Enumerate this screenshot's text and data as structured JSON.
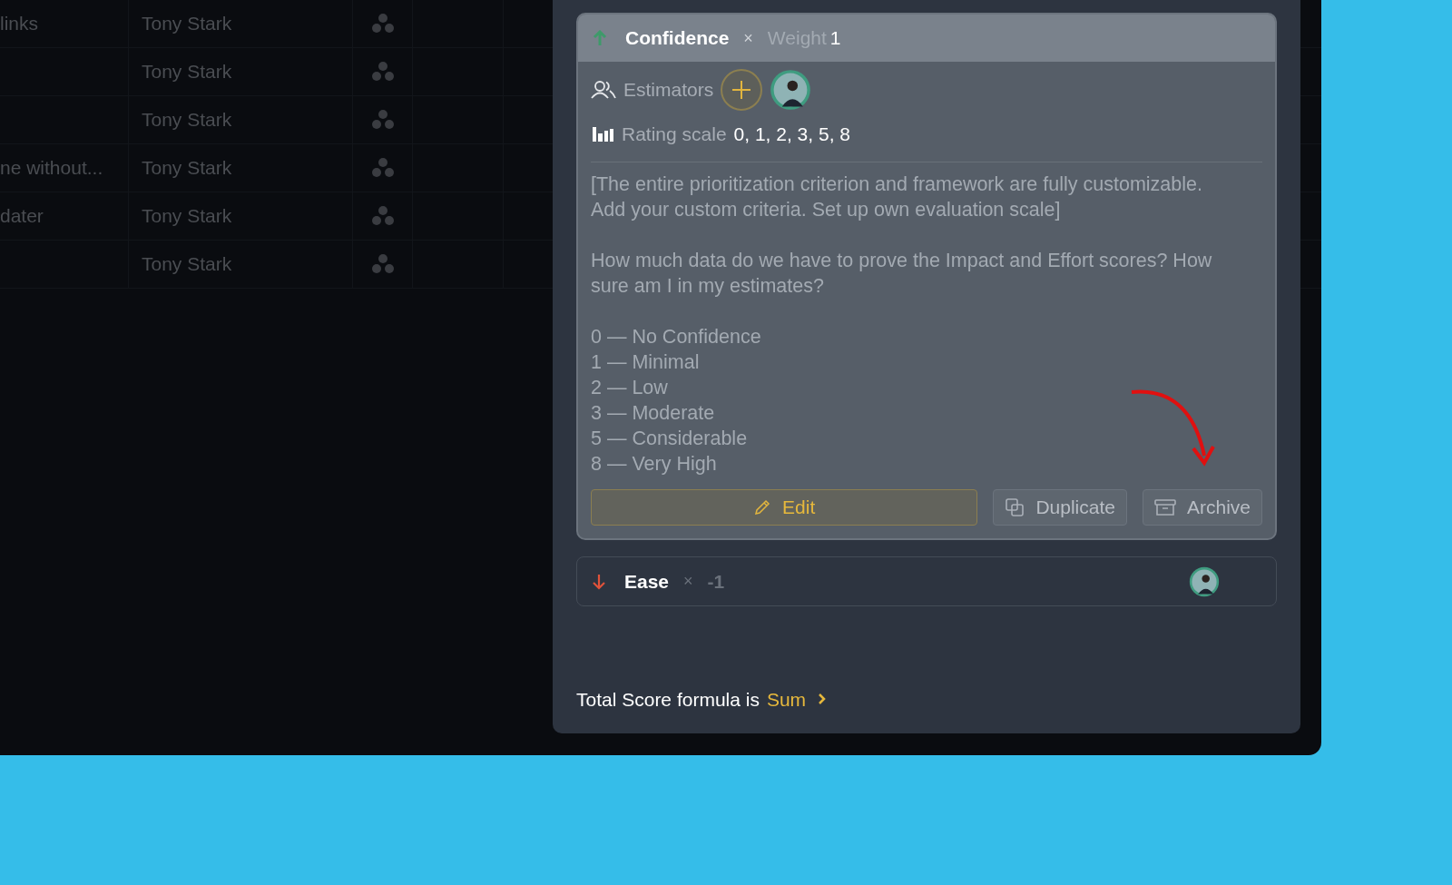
{
  "table": {
    "rows": [
      {
        "column_1": "links",
        "column_2": "Tony Stark"
      },
      {
        "column_2": "Tony Stark"
      },
      {
        "column_2": "Tony Stark"
      },
      {
        "column_1": "ne without...",
        "column_2": "Tony Stark"
      },
      {
        "column_1": "dater",
        "column_2": "Tony Stark"
      },
      {
        "column_2": "Tony Stark"
      }
    ]
  },
  "criteria": [
    {
      "name": "Confidence",
      "kind": "up",
      "operator": "×",
      "multiplier_label": "Weight",
      "weight": "1",
      "expanded": true,
      "estimators_label": "Estimators",
      "rating_label": "Rating scale",
      "rating_values": "0, 1, 2, 3, 5, 8",
      "description": [
        {
          "lines": [
            "[The entire prioritization criterion and framework are fully customizable.",
            "Add your custom criteria. Set up own evaluation scale]"
          ]
        },
        {
          "lines": [
            "How much data do we have to prove the Impact and Effort scores? How",
            "sure am I in my estimates?"
          ]
        }
      ],
      "scale_items": [
        "0 — No Confidence",
        "1 — Minimal",
        "2 — Low",
        "3 — Moderate",
        "5 — Considerable",
        "8 — Very High"
      ],
      "actions": [
        {
          "kind": "edit",
          "label": "Edit"
        },
        {
          "kind": "duplicate",
          "label": "Duplicate"
        },
        {
          "kind": "archive",
          "label": "Archive"
        }
      ]
    },
    {
      "name": "Ease",
      "kind": "down",
      "operator": "×",
      "weight": "-1",
      "expanded": false
    }
  ],
  "footer": {
    "text": "Total Score formula is",
    "value": "Sum"
  }
}
